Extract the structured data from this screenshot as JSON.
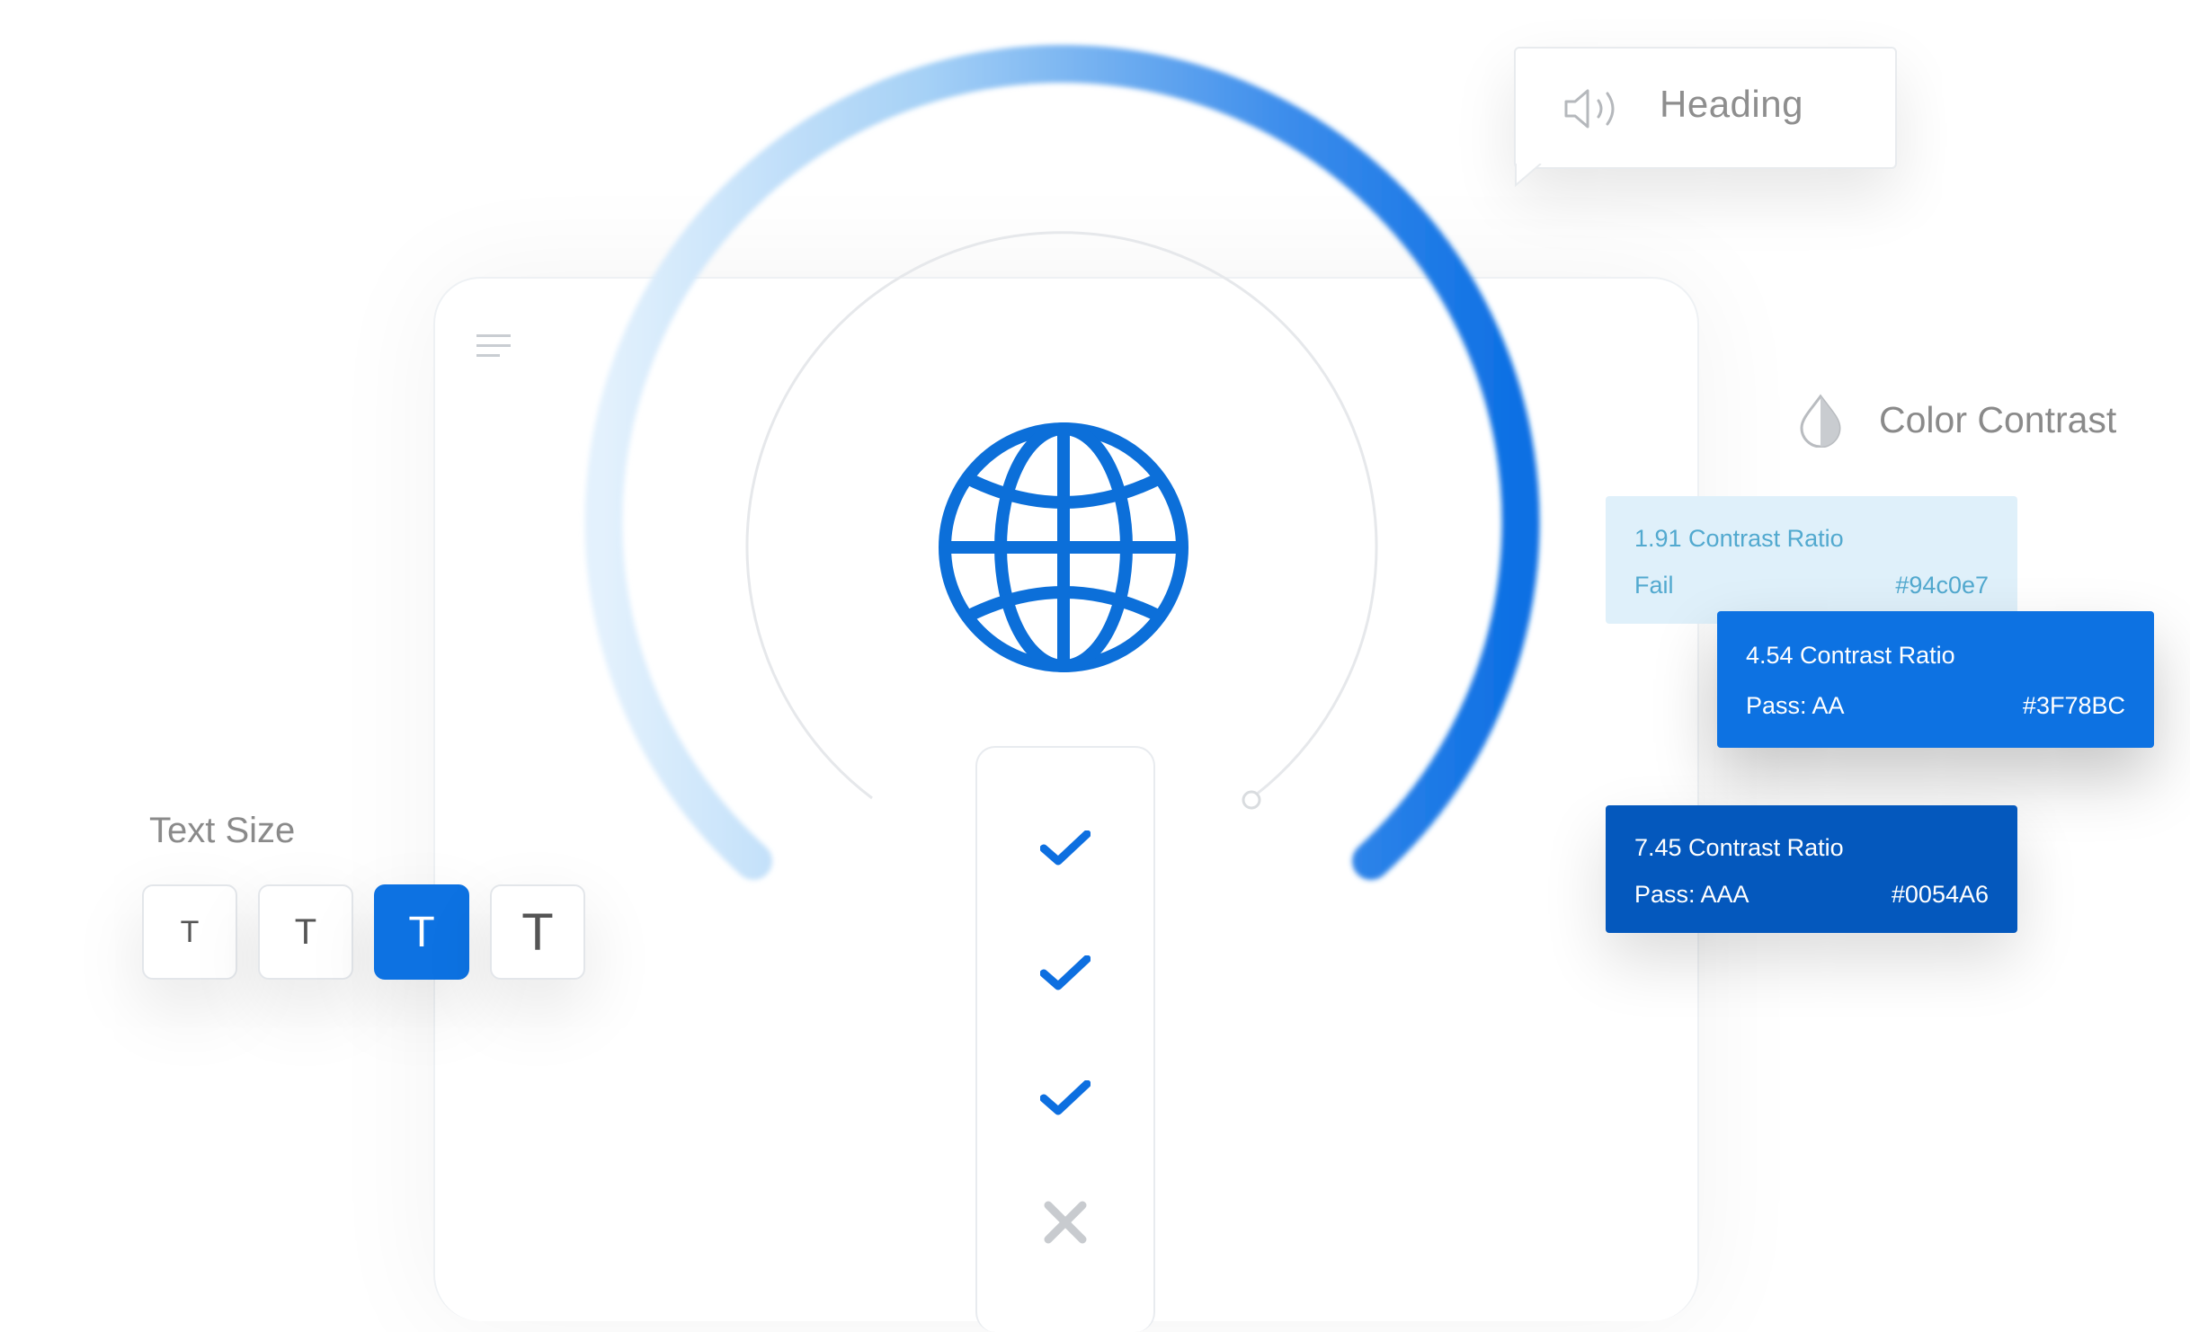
{
  "heading_tooltip": {
    "label": "Heading",
    "icon": "speaker-icon"
  },
  "color_contrast": {
    "title": "Color Contrast",
    "icon": "drop-icon",
    "cards": [
      {
        "ratio": "1.91 Contrast Ratio",
        "status": "Fail",
        "hex": "#94c0e7"
      },
      {
        "ratio": "4.54 Contrast Ratio",
        "status": "Pass: AA",
        "hex": "#3F78BC"
      },
      {
        "ratio": "7.45 Contrast Ratio",
        "status": "Pass: AAA",
        "hex": "#0054A6"
      }
    ]
  },
  "text_size": {
    "label": "Text Size",
    "buttons": [
      {
        "glyph": "T",
        "selected": false
      },
      {
        "glyph": "T",
        "selected": false
      },
      {
        "glyph": "T",
        "selected": true
      },
      {
        "glyph": "T",
        "selected": false
      }
    ]
  },
  "checklist": [
    {
      "state": "check",
      "icon": "checkmark-icon"
    },
    {
      "state": "check",
      "icon": "checkmark-icon"
    },
    {
      "state": "check",
      "icon": "checkmark-icon"
    },
    {
      "state": "fail",
      "icon": "close-icon"
    }
  ],
  "center_icon": "globe-icon",
  "colors": {
    "accent": "#0d72e2",
    "accent_dark": "#0458bd",
    "accent_light": "#dff0fa",
    "muted_text": "#8a8a8a"
  }
}
